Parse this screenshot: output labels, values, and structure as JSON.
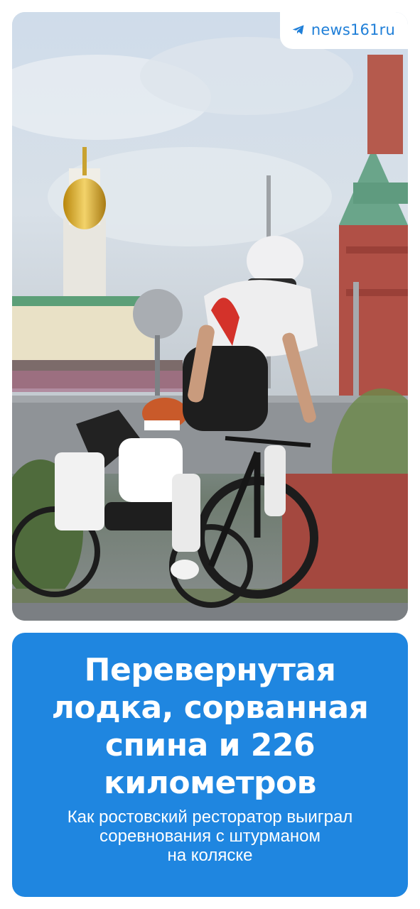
{
  "channel": {
    "name": "news161ru",
    "icon": "telegram-icon"
  },
  "photo": {
    "description_icon": "photo"
  },
  "article": {
    "headline": "Перевернутая\nлодка, сорванная\nспина и 226\nкилометров",
    "subheadline": "Как ростовский ресторатор выиграл\nсоревнования с штурманом\nна коляске"
  },
  "colors": {
    "accent": "#1f86e0",
    "channel_text": "#1f7fd8",
    "background": "#ffffff"
  }
}
